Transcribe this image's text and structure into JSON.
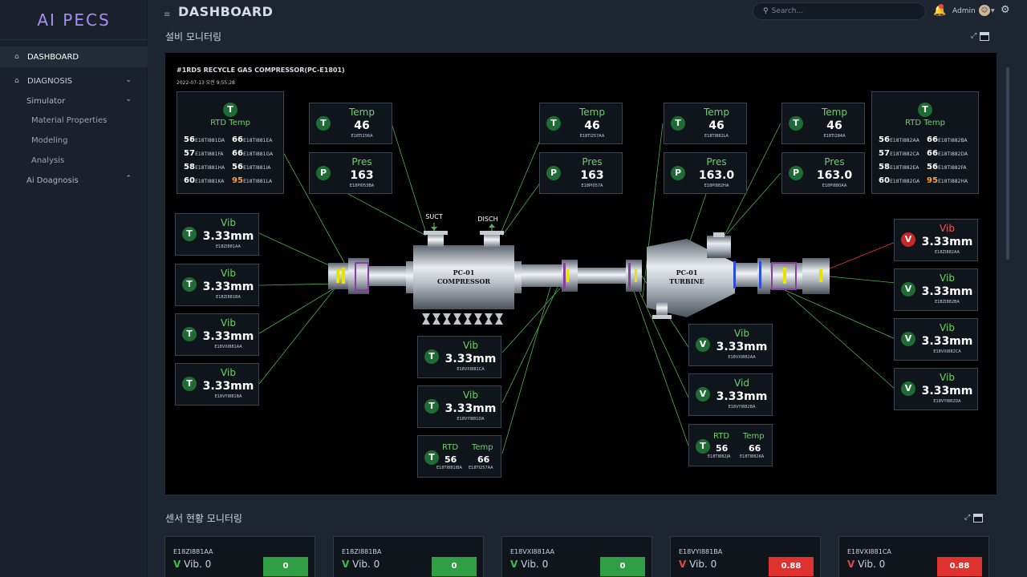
{
  "app": {
    "logo": "AI PECS"
  },
  "sidebar": {
    "items": [
      {
        "label": "DASHBOARD"
      },
      {
        "label": "DIAGNOSIS"
      },
      {
        "label": "Simulator"
      },
      {
        "label": "Material Properties"
      },
      {
        "label": "Modeling"
      },
      {
        "label": "Analysis"
      },
      {
        "label": "Ai Doagnosis"
      }
    ]
  },
  "header": {
    "title": "DASHBOARD",
    "search_placeholder": "Search...",
    "user": "Admin"
  },
  "sections": {
    "equipment": "설비 모니터링",
    "sensor": "센서 현황 모니터링"
  },
  "panel": {
    "title": "#1RDS RECYCLE GAS COMPRESSOR(PC-E1801)",
    "timestamp": "2022-07-13 오전 9:55:28",
    "compressor_label_1": "PC-01",
    "compressor_label_2": "COMPRESSOR",
    "turbine_label_1": "PC-01",
    "turbine_label_2": "TURBINE",
    "suct": "SUCT",
    "disch": "DISCH",
    "rtd_left": {
      "icon": "T",
      "title": "RTD Temp",
      "rows": [
        {
          "v1": "56",
          "t1": "E18TI881DA",
          "v2": "66",
          "t2": "E18TI881EA"
        },
        {
          "v1": "57",
          "t1": "E18TI881FA",
          "v2": "66",
          "t2": "E18TI881GA"
        },
        {
          "v1": "58",
          "t1": "E18TI881HA",
          "v2": "56",
          "t2": "E18TI881IA"
        },
        {
          "v1": "60",
          "t1": "E18TI881KA",
          "v2": "95",
          "t2": "E18TI881LA"
        }
      ]
    },
    "rtd_right": {
      "icon": "T",
      "title": "RTD Temp",
      "rows": [
        {
          "v1": "56",
          "t1": "E18TI882AA",
          "v2": "66",
          "t2": "E18TI882BA"
        },
        {
          "v1": "57",
          "t1": "E18TI882CA",
          "v2": "66",
          "t2": "E18TI882DA"
        },
        {
          "v1": "58",
          "t1": "E18TI882EA",
          "v2": "56",
          "t2": "E18TI882FA"
        },
        {
          "v1": "60",
          "t1": "E18TI882GA",
          "v2": "95",
          "t2": "E18TI882HA"
        }
      ]
    },
    "top_boxes": [
      {
        "icon": "T",
        "label": "Temp",
        "value": "46",
        "tag": "E18TI256A"
      },
      {
        "icon": "P",
        "label": "Pres",
        "value": "163",
        "tag": "E18PI053BA"
      },
      {
        "icon": "T",
        "label": "Temp",
        "value": "46",
        "tag": "E18TI257AA"
      },
      {
        "icon": "P",
        "label": "Pres",
        "value": "163",
        "tag": "E18PI057A"
      },
      {
        "icon": "T",
        "label": "Temp",
        "value": "46",
        "tag": "E18TI882LA"
      },
      {
        "icon": "P",
        "label": "Pres",
        "value": "163.0",
        "tag": "E18PI882HA"
      },
      {
        "icon": "T",
        "label": "Temp",
        "value": "46",
        "tag": "E18TI284A"
      },
      {
        "icon": "P",
        "label": "Pres",
        "value": "163.0",
        "tag": "E18PI880AA"
      }
    ],
    "left_vib": [
      {
        "icon": "T",
        "label": "Vib",
        "value": "3.33mm",
        "tag": "E18ZI881AA"
      },
      {
        "icon": "T",
        "label": "Vib",
        "value": "3.33mm",
        "tag": "E18ZI881BA"
      },
      {
        "icon": "T",
        "label": "Vib",
        "value": "3.33mm",
        "tag": "E18VXI881AA"
      },
      {
        "icon": "T",
        "label": "Vib",
        "value": "3.33mm",
        "tag": "E18VYI881BA"
      }
    ],
    "mid_vib": [
      {
        "icon": "T",
        "label": "Vib",
        "value": "3.33mm",
        "tag": "E18VXI881CA"
      },
      {
        "icon": "T",
        "label": "Vib",
        "value": "3.33mm",
        "tag": "E18VYI881DA"
      }
    ],
    "mid_rtd": {
      "icon": "T",
      "l1": "RTD",
      "l2": "Temp",
      "v1": "56",
      "v2": "66",
      "t1": "E18TI881IBA",
      "t2": "E18TI257AA"
    },
    "turb_vib": [
      {
        "icon": "V",
        "label": "Vib",
        "value": "3.33mm",
        "tag": "E18VXI882AA"
      },
      {
        "icon": "V",
        "label": "Vid",
        "value": "3.33mm",
        "tag": "E18VYI882BA"
      }
    ],
    "turb_rtd": {
      "icon": "T",
      "l1": "RTD",
      "l2": "Temp",
      "v1": "56",
      "v2": "66",
      "t1": "E18TI882JA",
      "t2": "E18TI882KA"
    },
    "right_vib": [
      {
        "icon": "V",
        "label": "Vib",
        "value": "3.33mm",
        "tag": "E18ZI882AA",
        "alarm": true
      },
      {
        "icon": "V",
        "label": "Vib",
        "value": "3.33mm",
        "tag": "E18ZI882BA",
        "alarm": false
      },
      {
        "icon": "V",
        "label": "Vib",
        "value": "3.33mm",
        "tag": "E18VXI882CA",
        "alarm": false
      },
      {
        "icon": "V",
        "label": "Vib",
        "value": "3.33mm",
        "tag": "E18VYI882DA",
        "alarm": false
      }
    ]
  },
  "cards": [
    {
      "tag": "E18ZI881AA",
      "vlabel": "V",
      "text": "Vib. 0",
      "badge": "0",
      "status": "g"
    },
    {
      "tag": "E18ZI881BA",
      "vlabel": "V",
      "text": "Vib. 0",
      "badge": "0",
      "status": "g"
    },
    {
      "tag": "E18VXI881AA",
      "vlabel": "V",
      "text": "Vib. 0",
      "badge": "0",
      "status": "g"
    },
    {
      "tag": "E18VYI881BA",
      "vlabel": "V",
      "text": "Vib. 0",
      "badge": "0.88",
      "status": "r"
    },
    {
      "tag": "E18VXI881CA",
      "vlabel": "V",
      "text": "Vib. 0",
      "badge": "0.88",
      "status": "r"
    }
  ],
  "colors": {
    "accent": "#a98cf7",
    "ok": "#2f9e44",
    "alarm": "#e03131",
    "label_green": "#6cd16b",
    "warn": "#ff9c3a"
  }
}
